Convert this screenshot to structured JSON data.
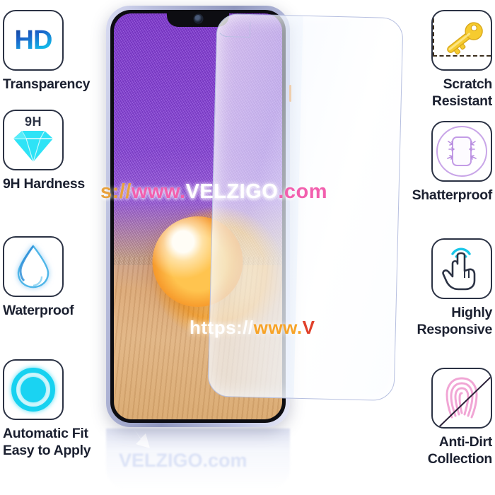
{
  "product": {
    "type": "tempered-glass-screen-protector",
    "device_color": "#b9bedd"
  },
  "features_left": [
    {
      "icon": "hd-icon",
      "icon_text": "HD",
      "label": "Transparency"
    },
    {
      "icon": "diamond-icon",
      "icon_text": "9H",
      "label": "9H Hardness"
    },
    {
      "icon": "water-drop-icon",
      "icon_text": "",
      "label": "Waterproof"
    },
    {
      "icon": "target-ring-icon",
      "icon_text": "",
      "label": "Automatic Fit\nEasy to Apply"
    }
  ],
  "features_right": [
    {
      "icon": "key-scratch-icon",
      "icon_text": "",
      "label": "Scratch\nResistant"
    },
    {
      "icon": "shatterproof-icon",
      "icon_text": "",
      "label": "Shatterproof"
    },
    {
      "icon": "touch-hand-icon",
      "icon_text": "",
      "label": "Highly\nResponsive"
    },
    {
      "icon": "fingerprint-icon",
      "icon_text": "",
      "label": "Anti-Dirt\nCollection"
    }
  ],
  "watermarks": {
    "top": {
      "prefix": "s://",
      "mid": "www.",
      "brand": "VELZIGO",
      "suffix": ".com"
    },
    "bottom": {
      "prefix": "https://",
      "mid": "www.",
      "brand": "V",
      "suffix": ""
    },
    "reflection": "VELZIGO.com"
  },
  "colors": {
    "accent_cyan": "#1ad3f2",
    "accent_pink": "#f25fae",
    "accent_orange": "#f7a327",
    "key_gold": "#f2c52a",
    "shatter_purple": "#c39ce6",
    "fingerprint_pink": "#f0a0d0",
    "text_dark": "#1b2030",
    "icon_border": "#2b3244"
  }
}
